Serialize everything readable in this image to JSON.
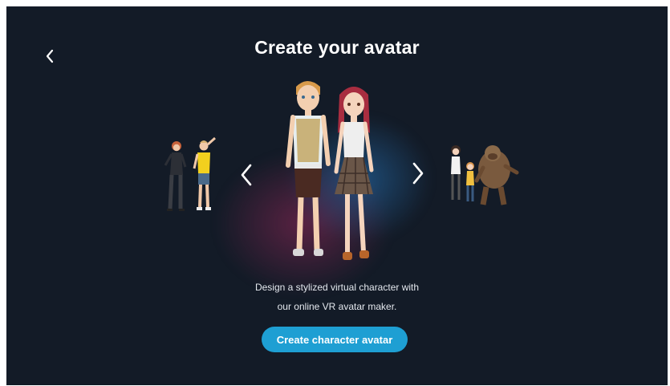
{
  "header": {
    "back_icon": "chevron-left-icon",
    "title": "Create your avatar"
  },
  "carousel": {
    "prev_icon": "chevron-left-icon",
    "next_icon": "chevron-right-icon",
    "slides": [
      {
        "id": "left",
        "description": "casual pair avatars (woman in dark outfit, man in yellow shirt)"
      },
      {
        "id": "center",
        "description": "stylized couple avatars (man in tan vest, woman in plaid skirt)",
        "active": true
      },
      {
        "id": "right",
        "description": "group with girl, child and big ape creature"
      }
    ]
  },
  "content": {
    "description_line1": "Design a stylized virtual character with",
    "description_line2": "our online VR avatar maker."
  },
  "cta": {
    "label": "Create character avatar"
  },
  "colors": {
    "background": "#131b27",
    "accent": "#1e9fd3",
    "text": "#ffffff"
  }
}
